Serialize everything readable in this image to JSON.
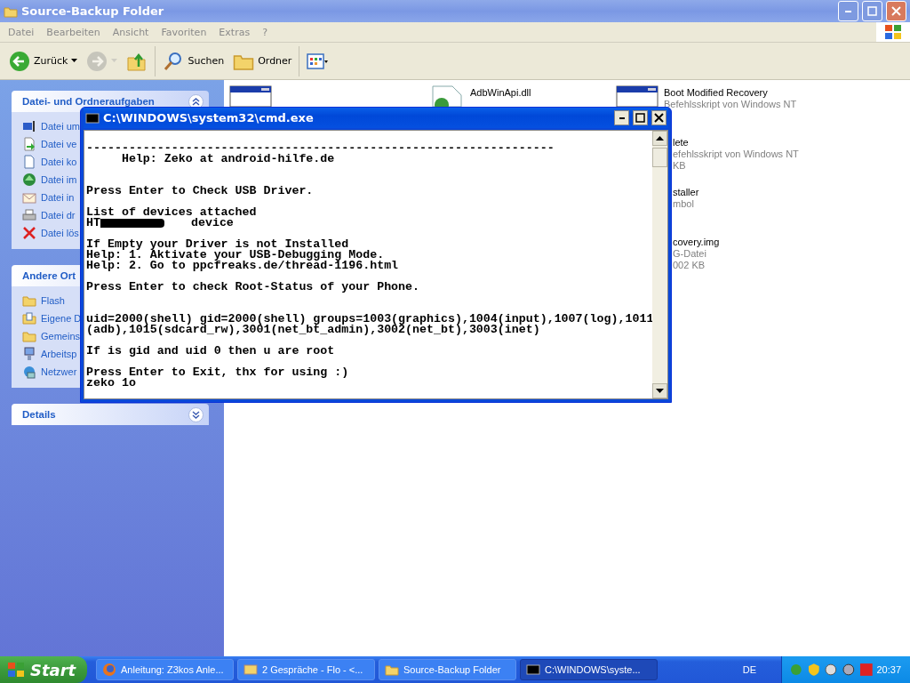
{
  "explorer": {
    "title": "Source-Backup Folder",
    "active": false,
    "menu": [
      "Datei",
      "Bearbeiten",
      "Ansicht",
      "Favoriten",
      "Extras",
      "?"
    ],
    "toolbar": [
      {
        "kind": "back",
        "label": "Zurück",
        "disabled": false
      },
      {
        "kind": "forward",
        "disabled": true
      },
      {
        "kind": "up",
        "disabled": false
      },
      {
        "kind": "search",
        "label": "Suchen",
        "disabled": false
      },
      {
        "kind": "folders",
        "label": "Ordner",
        "disabled": false
      },
      {
        "kind": "views",
        "disabled": false
      }
    ],
    "task_pane": [
      {
        "title": "Datei- und Ordneraufgaben",
        "toggle": true,
        "expanded": true,
        "items": [
          {
            "kind": "rename",
            "label": "Datei um"
          },
          {
            "kind": "move",
            "label": "Datei ve"
          },
          {
            "kind": "copy",
            "label": "Datei ko"
          },
          {
            "kind": "web",
            "label": "Datei im"
          },
          {
            "kind": "mail",
            "label": "Datei in"
          },
          {
            "kind": "print",
            "label": "Datei dr"
          },
          {
            "kind": "delete",
            "label": "Datei lös"
          }
        ]
      },
      {
        "title": "Andere Ort",
        "toggle": false,
        "expanded": true,
        "items": [
          {
            "kind": "folder",
            "label": "Flash"
          },
          {
            "kind": "docs",
            "label": "Eigene D"
          },
          {
            "kind": "folder",
            "label": "Gemeins"
          },
          {
            "kind": "computer",
            "label": "Arbeitsp"
          },
          {
            "kind": "network",
            "label": "Netzwer"
          }
        ]
      },
      {
        "title": "Details",
        "toggle": true,
        "expanded": false
      }
    ],
    "files": [
      {
        "kind": "batch"
      },
      {
        "kind": "dll",
        "name": "AdbWinApi.dll"
      },
      {
        "kind": "batch",
        "name": "Boot Modified Recovery",
        "lines": [
          "Befehlsskript von Windows NT"
        ]
      },
      {
        "kind": "none"
      },
      {
        "kind": "none"
      },
      {
        "kind": "covered",
        "name": "lete",
        "lines": [
          "efehlsskript von Windows NT",
          "KB"
        ]
      },
      {
        "kind": "none"
      },
      {
        "kind": "none"
      },
      {
        "kind": "covered",
        "name": "staller",
        "lines": [
          "mbol"
        ]
      },
      {
        "kind": "none"
      },
      {
        "kind": "none"
      },
      {
        "kind": "covered",
        "name": "covery.img",
        "lines": [
          "G-Datei",
          "002 KB"
        ]
      }
    ]
  },
  "console": {
    "title": "C:\\WINDOWS\\system32\\cmd.exe",
    "active": true,
    "paragraphs": [
      {
        "wide_gap": false,
        "lines": [
          {
            "kind": "text",
            "text": "------------------------------------------------------------------"
          },
          {
            "kind": "text",
            "text": "     Help: Zeko at android-hilfe.de"
          }
        ]
      },
      {
        "wide_gap": true,
        "lines": [
          {
            "kind": "text",
            "text": "Press Enter to Check USB Driver."
          }
        ]
      },
      {
        "wide_gap": false,
        "lines": [
          {
            "kind": "text",
            "text": "List of devices attached"
          },
          {
            "kind": "device",
            "text": "HT",
            "suffix": "device"
          }
        ]
      },
      {
        "wide_gap": false,
        "lines": [
          {
            "kind": "text",
            "text": "If Empty your Driver is not Installed"
          },
          {
            "kind": "text",
            "text": "Help: 1. Aktivate your USB-Debugging Mode."
          },
          {
            "kind": "text",
            "text": "Help: 2. Go to ppcfreaks.de/thread-1196.html"
          }
        ]
      },
      {
        "wide_gap": false,
        "lines": [
          {
            "kind": "text",
            "text": "Press Enter to check Root-Status of your Phone."
          }
        ]
      },
      {
        "wide_gap": true,
        "lines": [
          {
            "kind": "text",
            "text": "uid=2000(shell) gid=2000(shell) groups=1003(graphics),1004(input),1007(log),1011"
          },
          {
            "kind": "text",
            "text": "(adb),1015(sdcard_rw),3001(net_bt_admin),3002(net_bt),3003(inet)"
          }
        ]
      },
      {
        "wide_gap": false,
        "lines": [
          {
            "kind": "text",
            "text": "If is gid and uid 0 then u are root"
          }
        ]
      },
      {
        "wide_gap": false,
        "lines": [
          {
            "kind": "text",
            "text": "Press Enter to Exit, thx for using :)"
          },
          {
            "kind": "text",
            "text": "zeko 1o"
          }
        ]
      }
    ]
  },
  "taskbar": {
    "start": "Start",
    "tasks": [
      {
        "kind": "browser",
        "label": "Anleitung: Z3kos Anle...",
        "selected": false
      },
      {
        "kind": "chat",
        "label": "2 Gespräche - Flo - <...",
        "selected": false
      },
      {
        "kind": "folder",
        "label": "Source-Backup Folder",
        "selected": false
      },
      {
        "kind": "console",
        "label": "C:\\WINDOWS\\syste...",
        "selected": true
      }
    ],
    "language": "DE",
    "clock": "20:37"
  }
}
